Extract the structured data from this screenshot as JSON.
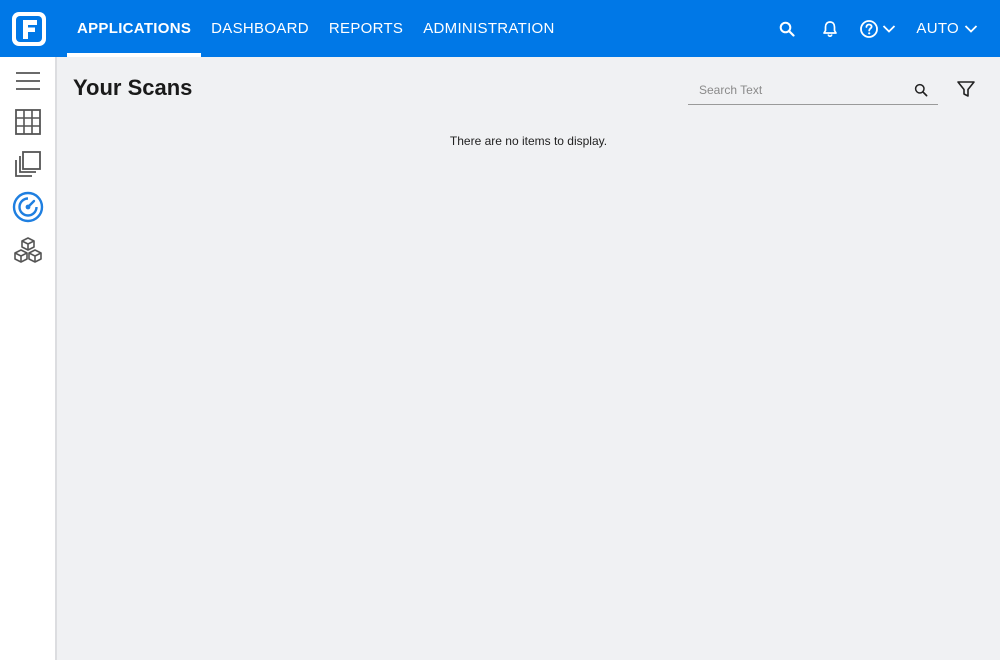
{
  "header": {
    "nav": [
      {
        "label": "APPLICATIONS",
        "active": true
      },
      {
        "label": "DASHBOARD",
        "active": false
      },
      {
        "label": "REPORTS",
        "active": false
      },
      {
        "label": "ADMINISTRATION",
        "active": false
      }
    ],
    "user_label": "AUTO",
    "icons": [
      "logo-icon",
      "search-icon",
      "bell-icon",
      "help-icon",
      "chevron-down-icon"
    ],
    "accent_color": "#0078e7"
  },
  "sidebar": {
    "items": [
      {
        "icon": "menu-icon"
      },
      {
        "icon": "grid-icon"
      },
      {
        "icon": "copy-icon"
      },
      {
        "icon": "scan-gauge-icon",
        "active": true
      },
      {
        "icon": "cubes-icon"
      }
    ]
  },
  "main": {
    "title": "Your Scans",
    "search": {
      "placeholder": "Search Text",
      "value": ""
    },
    "empty_message": "There are no items to display."
  }
}
